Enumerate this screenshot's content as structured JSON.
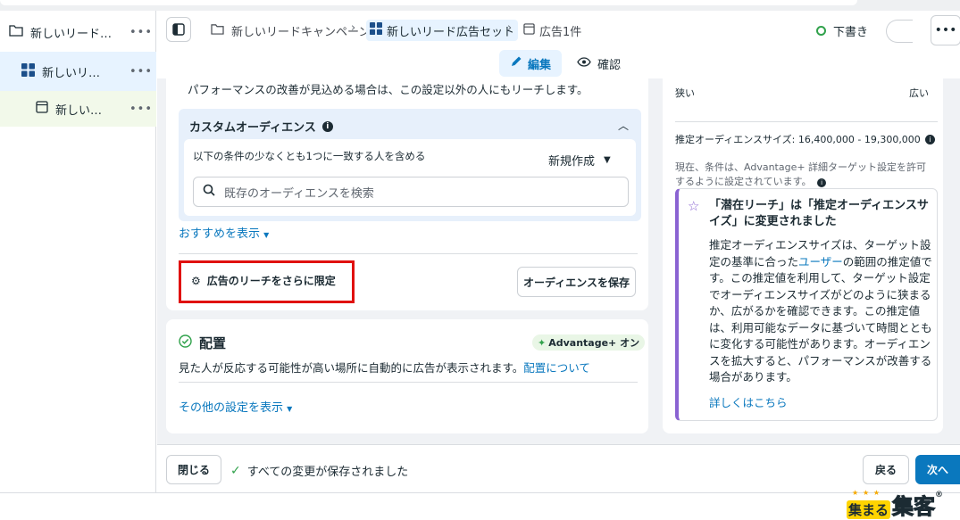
{
  "sidebar": {
    "items": [
      {
        "label": "新しいリード…",
        "more": "•••"
      },
      {
        "label": "新しいリ…",
        "more": "•••"
      },
      {
        "label": "新しい…",
        "more": "•••"
      }
    ]
  },
  "breadcrumb": {
    "campaign": "新しいリードキャンペーン",
    "adset": "新しいリード広告セット",
    "ad": "広告1件"
  },
  "status": {
    "draft": "下書き"
  },
  "more_label": "•••",
  "tabs": {
    "edit": "編集",
    "review": "確認"
  },
  "audience": {
    "top_note": "パフォーマンスの改善が見込める場合は、この設定以外の人にもリーチします。",
    "custom_title": "カスタムオーディエンス",
    "condition": "以下の条件の少なくとも1つに一致する人を含める",
    "new_create": "新規作成",
    "search_placeholder": "既存のオーディエンスを検索",
    "recommend": "おすすめを表示",
    "limit_reach": "広告のリーチをさらに限定",
    "save_audience": "オーディエンスを保存"
  },
  "placement": {
    "title": "配置",
    "badge": "Advantage+ オン",
    "description": "見た人が反応する可能性が高い場所に自動的に広告が表示されます。",
    "link": "配置について",
    "other_settings": "その他の設定を表示"
  },
  "estimate": {
    "narrow": "狭い",
    "wide": "広い",
    "size_label": "推定オーディエンスサイズ: 16,400,000 - 19,300,000",
    "current_note": "現在、条件は、Advantage+ 詳細ターゲット設定を許可するように設定されています。",
    "info_title": "「潜在リーチ」は「推定オーディエンスサイズ」に変更されました",
    "info_body_1": "推定オーディエンスサイズは、ターゲット設定の基準に合った",
    "info_body_link": "ユーザー",
    "info_body_2": "の範囲の推定値です。この推定値を利用して、ターゲット設定でオーディエンスサイズがどのように狭まるか、広がるかを確認できます。この推定値は、利用可能なデータに基づいて時間とともに変化する可能性があります。オーディエンスを拡大すると、パフォーマンスが改善する場合があります。",
    "learn_more": "詳しくはこちら"
  },
  "footer": {
    "close": "閉じる",
    "saved": "すべての変更が保存されました",
    "back": "戻る",
    "next": "次へ"
  },
  "logo": {
    "small": "集まる",
    "big": "集客",
    "mark": "®"
  },
  "colors": {
    "accent": "#0a78be",
    "highlight_border": "#e0110f",
    "info_bar": "#8a63d2"
  }
}
